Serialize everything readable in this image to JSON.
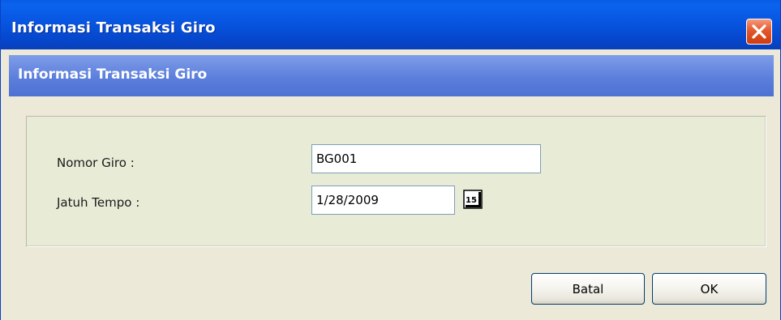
{
  "window": {
    "title": "Informasi Transaksi Giro"
  },
  "header": {
    "title": "Informasi Transaksi Giro"
  },
  "form": {
    "nomor_giro_label": "Nomor Giro :",
    "nomor_giro_value": "BG001",
    "jatuh_tempo_label": "Jatuh Tempo :",
    "jatuh_tempo_value": "1/28/2009",
    "calendar_icon_text": "15"
  },
  "buttons": {
    "cancel": "Batal",
    "ok": "OK"
  },
  "icons": {
    "close": "close-icon",
    "calendar": "calendar-icon"
  },
  "colors": {
    "titlebar": "#0753de",
    "close": "#e4582b",
    "header_band": "#5c7fdc",
    "panel": "#e8ecd7",
    "window": "#ece9d8"
  }
}
